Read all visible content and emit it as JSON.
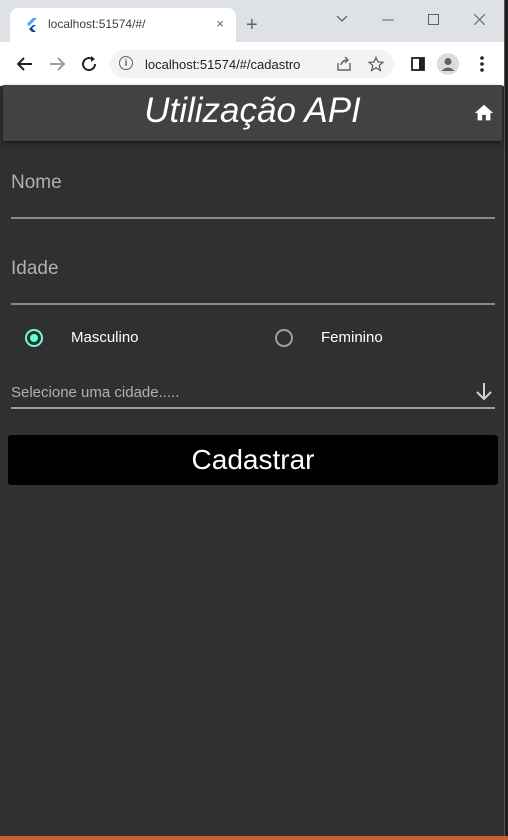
{
  "browser": {
    "tab_title": "localhost:51574/#/",
    "tab_close": "×",
    "new_tab": "+",
    "url": "localhost:51574/#/cadastro"
  },
  "app": {
    "title": "Utilização API",
    "background": "#303030",
    "appbar_color": "#424242",
    "accent": "#64ffda"
  },
  "form": {
    "nome_label": "Nome",
    "idade_label": "Idade",
    "gender_options": [
      "Masculino",
      "Feminino"
    ],
    "gender_selected": "Masculino",
    "city_hint": "Selecione uma cidade.....",
    "submit_label": "Cadastrar"
  },
  "icons": {
    "home": "home-icon",
    "dropdown": "arrow-down-icon",
    "back": "back-arrow-icon",
    "forward": "forward-arrow-icon",
    "reload": "reload-icon"
  }
}
